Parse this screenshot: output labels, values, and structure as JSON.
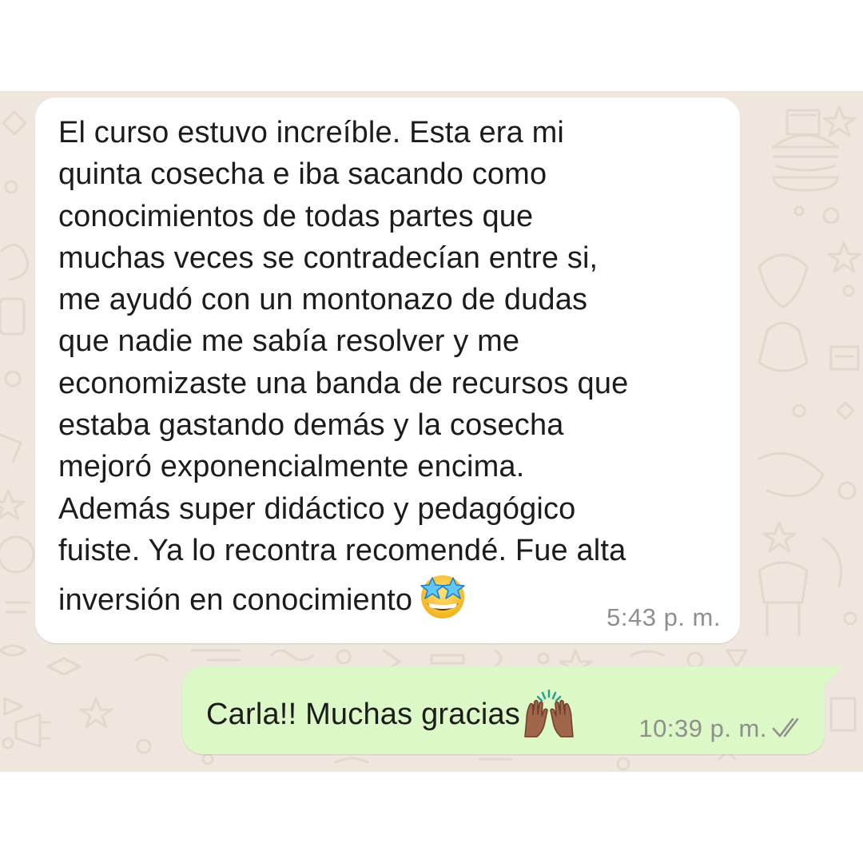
{
  "conversation": {
    "incoming": {
      "text": "El curso estuvo increíble. Esta era mi\nquinta cosecha e iba sacando como\nconocimientos de todas partes que\nmuchas veces se contradecían entre si,\nme ayudó con un montonazo de dudas\nque nadie me sabía resolver y me\neconomizaste una banda de recursos que\nestaba gastando demás y la cosecha\nmejoró exponencialmente encima.\nAdemás super didáctico y pedagógico\nfuiste. Ya lo recontra recomendé. Fue alta\ninversión en conocimiento",
      "emoji": "star-struck-emoji",
      "time": "5:43 p. m."
    },
    "outgoing": {
      "text": "Carla!! Muchas gracias",
      "emoji": "raising-hands-emoji",
      "time": "10:39 p. m.",
      "status_icon": "double-check-icon"
    }
  },
  "colors": {
    "wallpaper": "#efe7dd",
    "incoming_bubble": "#ffffff",
    "outgoing_bubble": "#dcf8c6",
    "timestamp": "#8f8f8f",
    "read_ticks": "#8f8f8f"
  }
}
